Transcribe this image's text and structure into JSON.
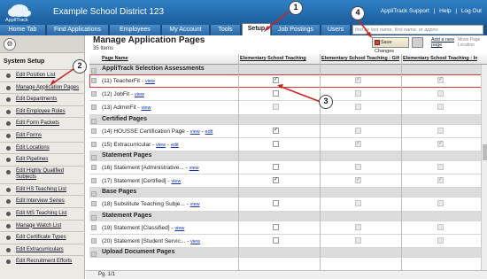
{
  "header": {
    "logo_text": "AppliTrack",
    "district": "Example School District 123",
    "links": [
      "AppliTrack Support",
      "|",
      "Help",
      "|",
      "Log Out"
    ]
  },
  "tabs": [
    "Home Tab",
    "Find Applications",
    "Employees",
    "My Account",
    "Tools",
    "Setup",
    "Job Postings",
    "Users"
  ],
  "find": {
    "placeholder": "find by last name, first name, or appno"
  },
  "sidebar": {
    "title": "System Setup",
    "items": [
      "Edit Position List",
      "Manage Application Pages",
      "Edit Departments",
      "Edit Employee Roles",
      "Edit Form Packets",
      "Edit Forms",
      "Edit Locations",
      "Edit Pipelines",
      "Edit Highly Qualified Subjects",
      "Edit HS Teaching List",
      "Edit Interview Series",
      "Edit MS Teaching List",
      "Manage Watch List",
      "Edit Certificate Types",
      "Edit Extracurriculars",
      "Edit Recruitment Efforts"
    ]
  },
  "main": {
    "title": "Manage Application Pages",
    "count": "35 Items",
    "save_label": "Save Changes",
    "add_link": "Add a new page",
    "move_link": "Move Page Location",
    "columns": [
      "Page Name",
      "Elementary School Teaching",
      "Elementary School Teaching : Gifted",
      "Elementary School Teaching : Intermed"
    ],
    "view_label": "view",
    "edit_label": "edit",
    "footer": "Pg. 1/1",
    "sections": [
      {
        "title": "AppliTrack Selection Assessments",
        "rows": [
          {
            "name": "(11) TeacherFit",
            "checks": [
              true,
              true,
              true
            ],
            "enabled": [
              true,
              false,
              false
            ],
            "edit": false
          },
          {
            "name": "(12) JobFit",
            "checks": [
              false,
              false,
              false
            ],
            "enabled": [
              true,
              false,
              false
            ],
            "edit": false
          },
          {
            "name": "(13) AdminFit",
            "checks": [
              false,
              false,
              false
            ],
            "enabled": [
              false,
              false,
              false
            ],
            "edit": false
          }
        ]
      },
      {
        "title": "Certified Pages",
        "rows": [
          {
            "name": "(14) HOUSSE Certification Page",
            "checks": [
              true,
              false,
              false
            ],
            "enabled": [
              true,
              false,
              false
            ],
            "edit": true
          },
          {
            "name": "(15) Extracurricular",
            "checks": [
              false,
              true,
              true
            ],
            "enabled": [
              true,
              false,
              false
            ],
            "edit": true
          }
        ]
      },
      {
        "title": "Statement Pages",
        "rows": [
          {
            "name": "(16) Statement [Administrative...",
            "checks": [
              false,
              false,
              false
            ],
            "enabled": [
              true,
              false,
              false
            ],
            "edit": false
          },
          {
            "name": "(17) Statement [Certified]",
            "checks": [
              true,
              true,
              true
            ],
            "enabled": [
              true,
              false,
              false
            ],
            "edit": false
          }
        ]
      },
      {
        "title": "Base Pages",
        "rows": [
          {
            "name": "(18) Substitute Teaching Subje...",
            "checks": [
              false,
              false,
              false
            ],
            "enabled": [
              true,
              false,
              false
            ],
            "edit": false
          }
        ]
      },
      {
        "title": "Statement Pages",
        "rows": [
          {
            "name": "(19) Statement [Classified]",
            "checks": [
              false,
              false,
              false
            ],
            "enabled": [
              true,
              false,
              false
            ],
            "edit": false
          },
          {
            "name": "(20) Statement [Student Servic...",
            "checks": [
              false,
              false,
              false
            ],
            "enabled": [
              true,
              false,
              false
            ],
            "edit": false
          }
        ]
      },
      {
        "title": "Upload Document Pages",
        "rows": []
      }
    ]
  },
  "callouts": [
    "1",
    "2",
    "3",
    "4"
  ]
}
